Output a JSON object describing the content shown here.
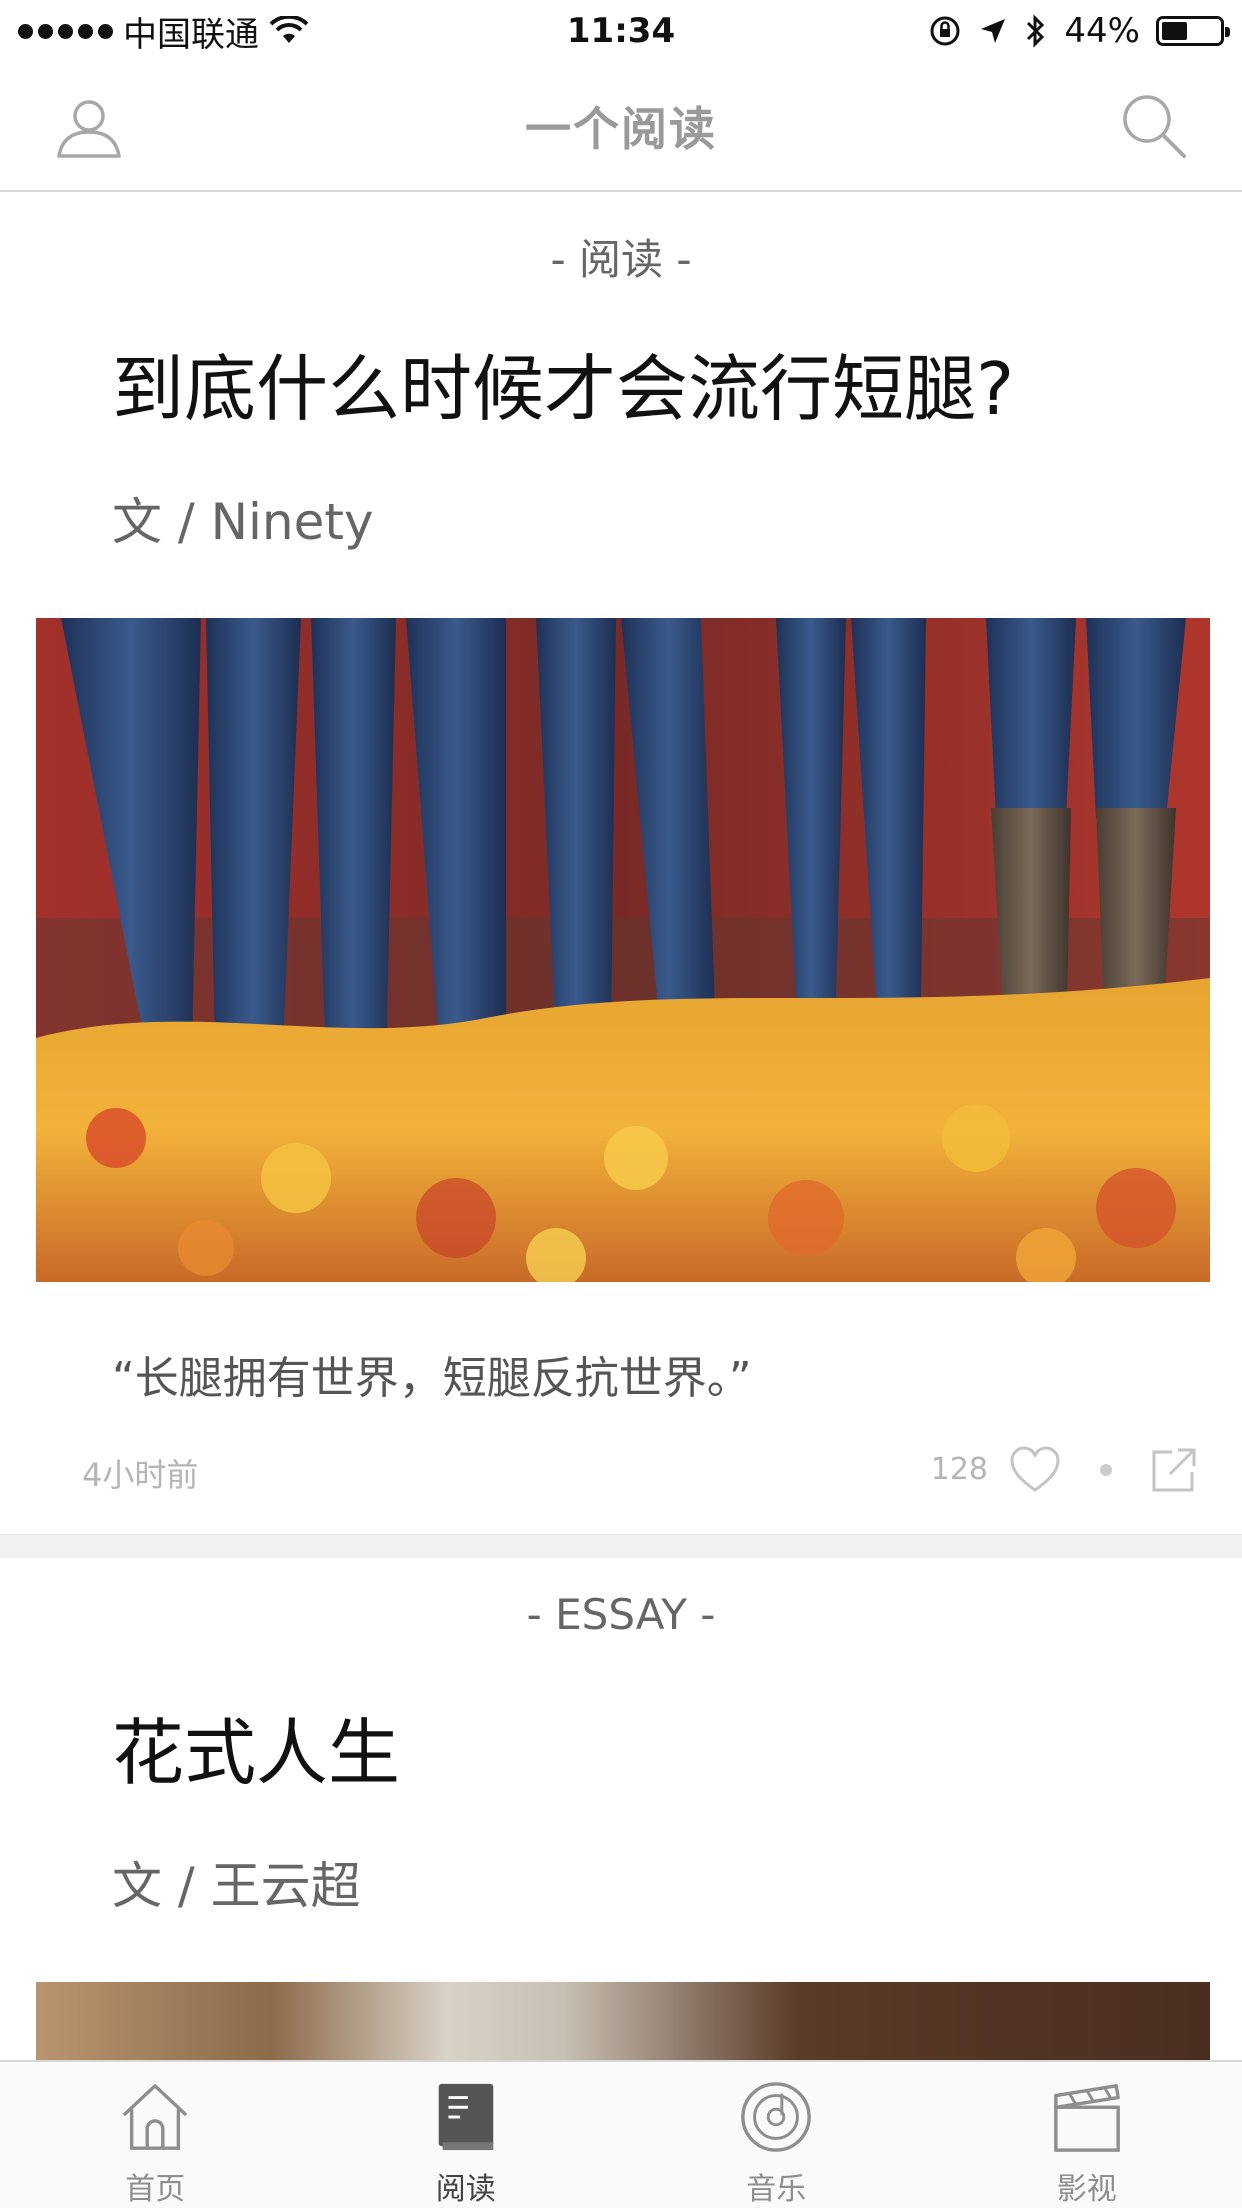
{
  "status_bar": {
    "carrier": "中国联通",
    "time": "11:34",
    "battery_percent": "44%",
    "battery_level": 0.44
  },
  "nav": {
    "title": "一个阅读"
  },
  "feed": {
    "cards": [
      {
        "category": "- 阅读 -",
        "title": "到底什么时候才会流行短腿?",
        "author": "文 / Ninety",
        "excerpt": "“长腿拥有世界，短腿反抗世界。”",
        "time": "4小时前",
        "likes": "128"
      },
      {
        "category": "- ESSAY -",
        "title": "花式人生",
        "author": "文 / 王云超"
      }
    ]
  },
  "tabs": [
    {
      "label": "首页",
      "icon": "home-icon"
    },
    {
      "label": "阅读",
      "icon": "book-icon"
    },
    {
      "label": "音乐",
      "icon": "music-disc-icon"
    },
    {
      "label": "影视",
      "icon": "clapperboard-icon"
    }
  ],
  "colors": {
    "nav_title": "#9a9a9a",
    "active_tab": "#444444",
    "inactive_tab": "#8e8e8e",
    "divider": "#d8d8d8"
  }
}
